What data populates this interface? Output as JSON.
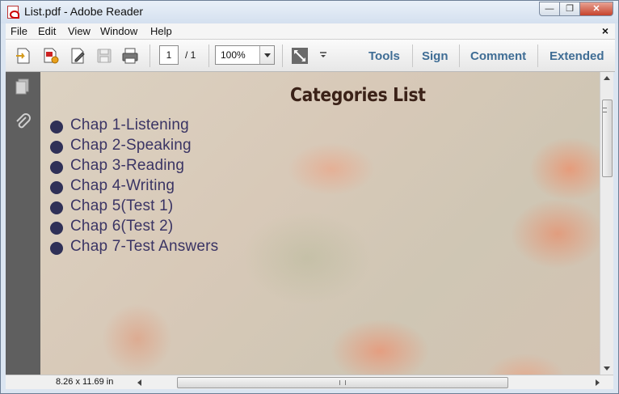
{
  "window": {
    "title": "List.pdf - Adobe Reader",
    "minimize_label": "—",
    "restore_label": "❐",
    "close_label": "✕"
  },
  "menubar": {
    "items": [
      {
        "label": "File"
      },
      {
        "label": "Edit"
      },
      {
        "label": "View"
      },
      {
        "label": "Window"
      },
      {
        "label": "Help"
      }
    ],
    "close_doc_label": "×"
  },
  "toolbar": {
    "icons": [
      "open-file-icon",
      "create-pdf-icon",
      "edit-sign-icon",
      "save-icon",
      "print-icon",
      "full-screen-icon",
      "more-tools-icon"
    ],
    "page_current": "1",
    "page_total": "/ 1",
    "zoom": "100%",
    "links": [
      {
        "label": "Tools"
      },
      {
        "label": "Sign"
      },
      {
        "label": "Comment"
      },
      {
        "label": "Extended"
      }
    ]
  },
  "left_panel": {
    "icons": [
      "pages-icon",
      "attachments-icon"
    ]
  },
  "document": {
    "title": "Categories List",
    "items": [
      {
        "label": "Chap 1-Listening"
      },
      {
        "label": "Chap 2-Speaking"
      },
      {
        "label": "Chap 3-Reading"
      },
      {
        "label": "Chap 4-Writing"
      },
      {
        "label": "Chap 5(Test 1)"
      },
      {
        "label": "Chap 6(Test 2)"
      },
      {
        "label": "Chap 7-Test Answers"
      }
    ]
  },
  "statusbar": {
    "page_size": "8.26 x 11.69 in"
  },
  "colors": {
    "toolbar_link": "#3f6d95",
    "bullet": "#2f3057",
    "list_text": "#3a3464",
    "title_text": "#3b2218",
    "left_panel": "#5f5f5f"
  }
}
